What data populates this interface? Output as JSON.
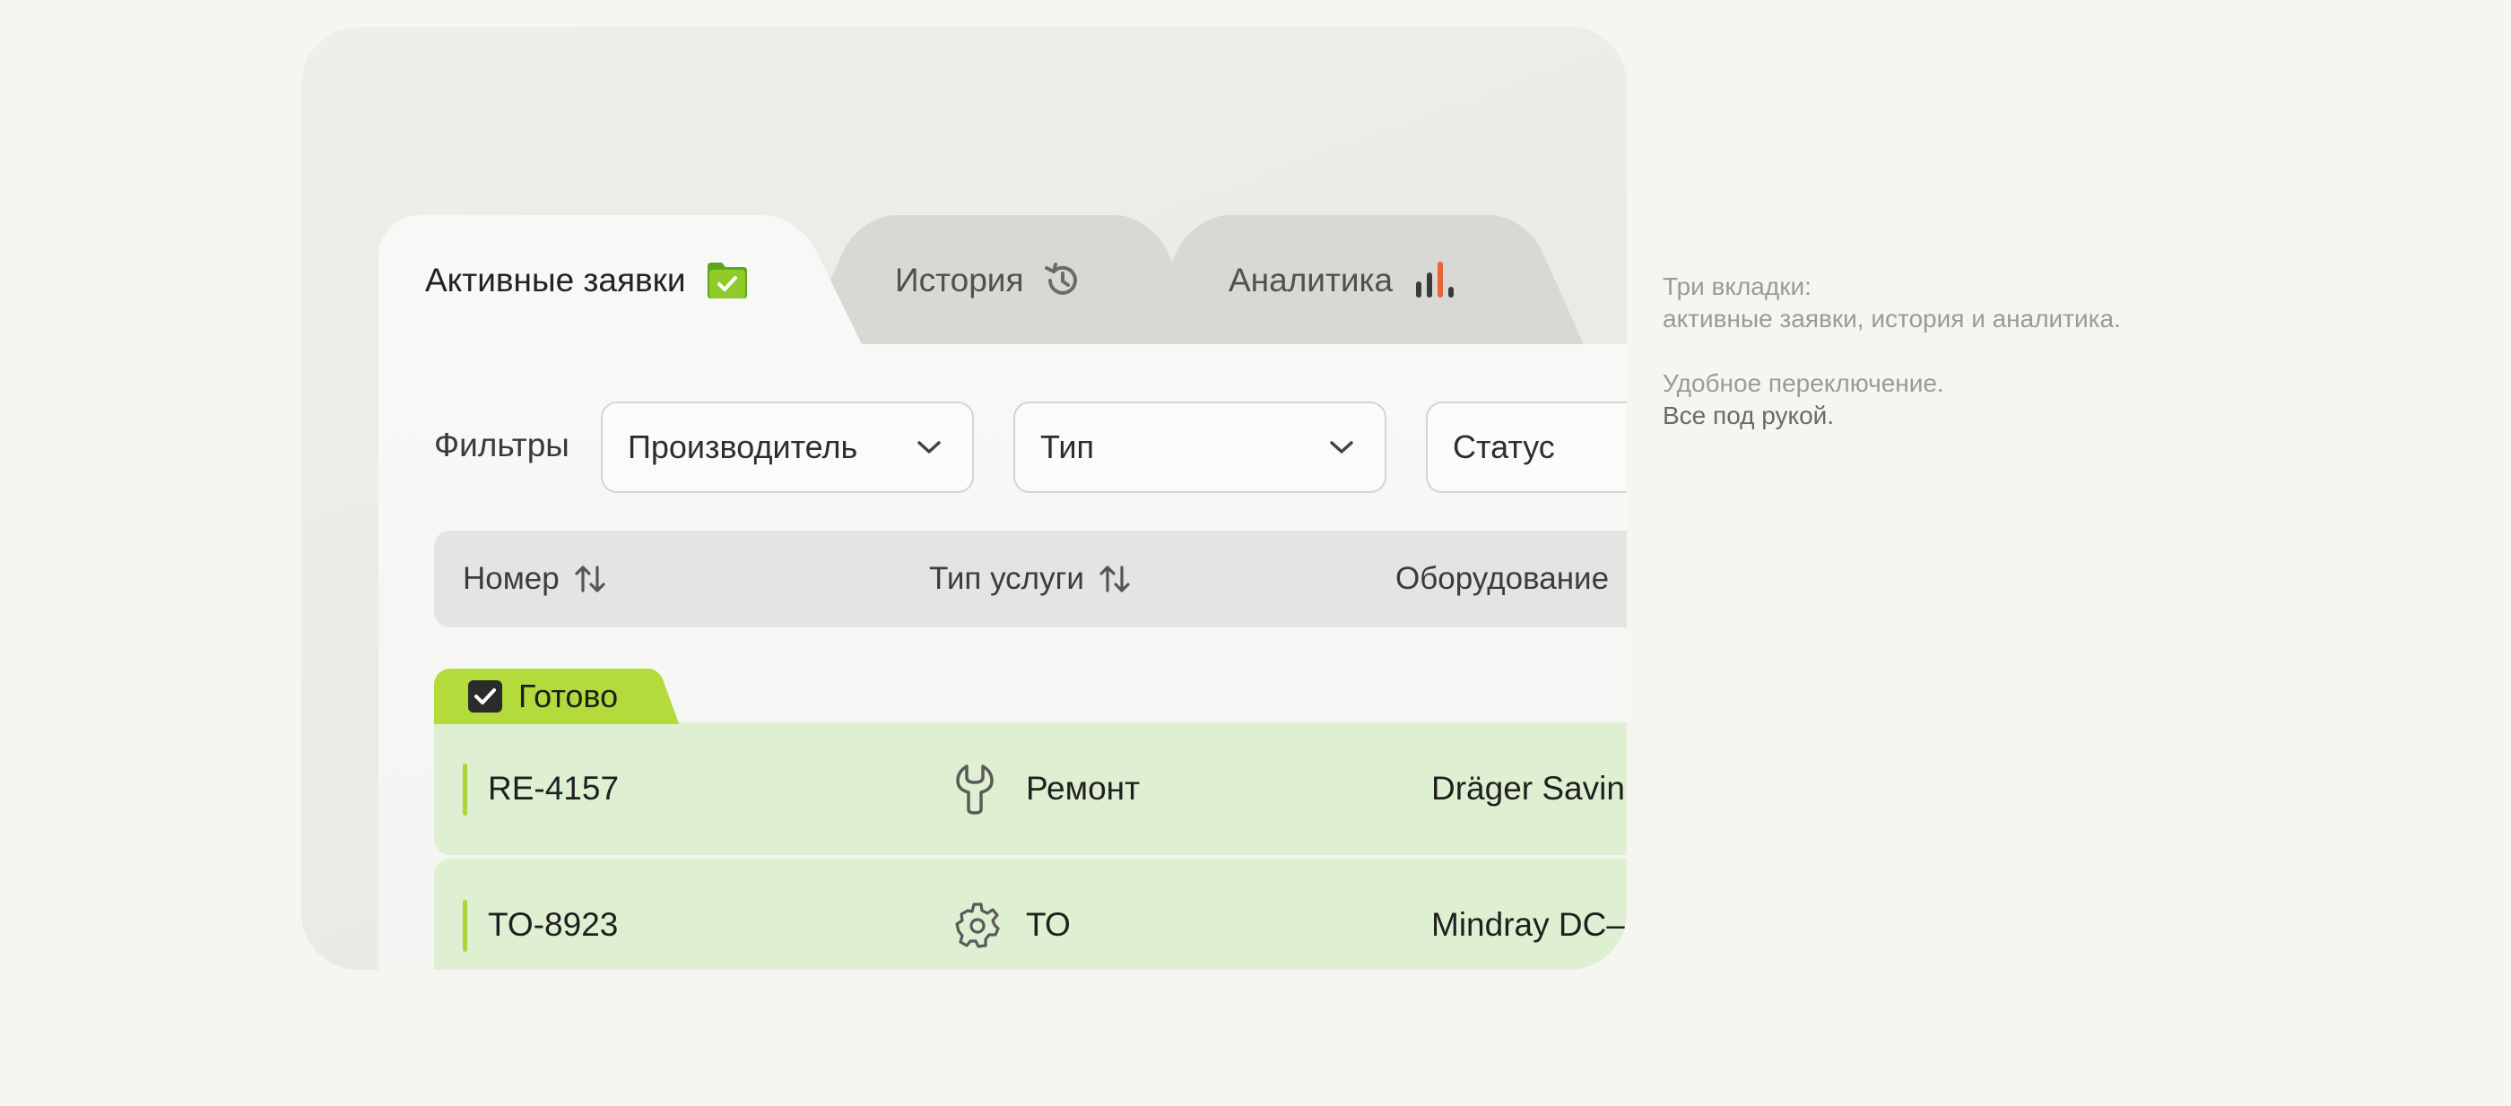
{
  "tabs": [
    {
      "label": "Активные заявки",
      "icon": "folder-check-icon",
      "active": true
    },
    {
      "label": "История",
      "icon": "history-icon",
      "active": false
    },
    {
      "label": "Аналитика",
      "icon": "bar-chart-icon",
      "active": false
    }
  ],
  "filters": {
    "label": "Фильтры",
    "manufacturer": "Производитель",
    "type": "Тип",
    "status": "Статус"
  },
  "table": {
    "columns": [
      {
        "label": "Номер",
        "sortable": true
      },
      {
        "label": "Тип услуги",
        "sortable": true
      },
      {
        "label": "Оборудование",
        "sortable": false
      }
    ],
    "group": {
      "label": "Готово",
      "icon": "checkbox-icon",
      "color": "#b3db3c"
    },
    "rows": [
      {
        "number": "RE-4157",
        "service": "Ремонт",
        "service_icon": "wrench-icon",
        "equipment": "Dräger Savin"
      },
      {
        "number": "TO-8923",
        "service": "ТО",
        "service_icon": "gear-icon",
        "equipment": "Mindray DC–"
      }
    ]
  },
  "notes": {
    "line1": "Три вкладки:",
    "line2": "активные заявки, история и аналитика.",
    "line3": "Удобное переключение.",
    "line4": "Все под рукой."
  },
  "colors": {
    "accent_green": "#b3db3c",
    "row_green": "#dff0d2",
    "analytics_accent": "#e8623a"
  }
}
